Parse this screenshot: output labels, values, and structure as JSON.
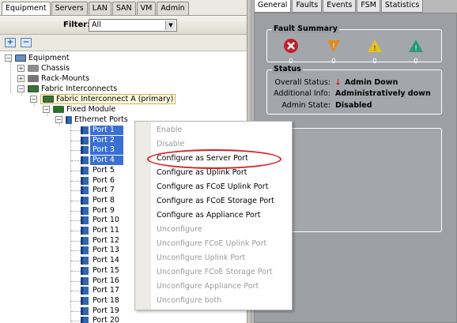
{
  "left_tabs": [
    "Equipment",
    "Servers",
    "LAN",
    "SAN",
    "VM",
    "Admin"
  ],
  "filter": {
    "label": "Filter:",
    "value": "All"
  },
  "toolbar": {
    "expand": "+",
    "collapse": "−"
  },
  "tree": {
    "root": "Equipment",
    "chassis": "Chassis",
    "rack_mounts": "Rack-Mounts",
    "fabric_interconnects": "Fabric Interconnects",
    "fi_a": "Fabric Interconnect A (primary)",
    "fixed_module": "Fixed Module",
    "ethernet_ports": "Ethernet Ports",
    "ports": [
      "Port 1",
      "Port 2",
      "Port 3",
      "Port 4",
      "Port 5",
      "Port 6",
      "Port 7",
      "Port 8",
      "Port 9",
      "Port 10",
      "Port 11",
      "Port 12",
      "Port 13",
      "Port 14",
      "Port 15",
      "Port 16",
      "Port 17",
      "Port 18",
      "Port 19",
      "Port 20"
    ],
    "selected_ports": [
      "Port 1",
      "Port 2",
      "Port 3",
      "Port 4"
    ]
  },
  "right_tabs": [
    "General",
    "Faults",
    "Events",
    "FSM",
    "Statistics"
  ],
  "fault_summary": {
    "title": "Fault Summary",
    "counts": [
      "0",
      "0",
      "0",
      "0"
    ],
    "colors": [
      "#c0202a",
      "#e08a20",
      "#e8c020",
      "#2a9a7a"
    ]
  },
  "status": {
    "title": "Status",
    "overall_label": "Overall Status:",
    "overall_value": "Admin Down",
    "additional_label": "Additional Info:",
    "additional_value": "Administratively down",
    "admin_state_label": "Admin State:",
    "admin_state_value": "Disabled"
  },
  "context_menu": {
    "items": [
      {
        "label": "Enable",
        "enabled": false
      },
      {
        "label": "Disable",
        "enabled": false
      },
      {
        "label": "Configure as Server Port",
        "enabled": true
      },
      {
        "label": "Configure as Uplink Port",
        "enabled": true
      },
      {
        "label": "Configure as FCoE Uplink Port",
        "enabled": true
      },
      {
        "label": "Configure as FCoE Storage Port",
        "enabled": true
      },
      {
        "label": "Configure as Appliance Port",
        "enabled": true
      },
      {
        "label": "Unconfigure",
        "enabled": false
      },
      {
        "label": "Unconfigure FCoE Uplink Port",
        "enabled": false
      },
      {
        "label": "Unconfigure Uplink Port",
        "enabled": false
      },
      {
        "label": "Unconfigure FCoE Storage Port",
        "enabled": false
      },
      {
        "label": "Unconfigure Appliance Port",
        "enabled": false
      },
      {
        "label": "Unconfigure both",
        "enabled": false
      }
    ]
  }
}
